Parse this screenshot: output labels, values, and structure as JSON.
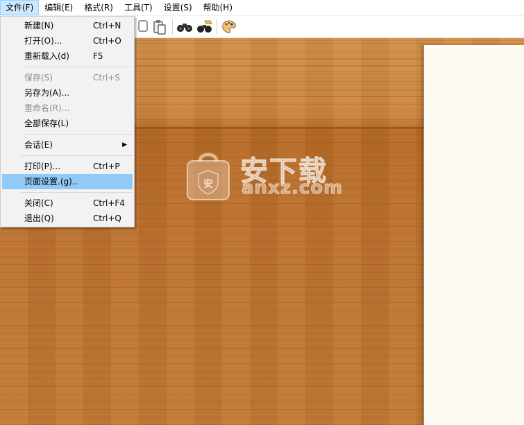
{
  "menubar": {
    "items": [
      {
        "label": "文件(F)",
        "active": true
      },
      {
        "label": "编辑(E)"
      },
      {
        "label": "格式(R)"
      },
      {
        "label": "工具(T)"
      },
      {
        "label": "设置(S)"
      },
      {
        "label": "帮助(H)"
      }
    ]
  },
  "toolbar": {
    "icons": [
      "copy-icon",
      "paste-icon",
      "find-binoculars-icon",
      "find-replace-icon",
      "palette-icon"
    ]
  },
  "file_menu": {
    "items": [
      {
        "label": "新建(N)",
        "shortcut": "Ctrl+N"
      },
      {
        "label": "打开(O)...",
        "shortcut": "Ctrl+O"
      },
      {
        "label": "重新载入(d)",
        "shortcut": "F5"
      },
      {
        "label": "保存(S)",
        "shortcut": "Ctrl+S",
        "disabled": true
      },
      {
        "label": "另存为(A)..."
      },
      {
        "label": "重命名(R)...",
        "disabled": true
      },
      {
        "label": "全部保存(L)"
      },
      {
        "label": "会话(E)",
        "submenu": true
      },
      {
        "label": "打印(P)...",
        "shortcut": "Ctrl+P"
      },
      {
        "label": "页面设置.(g)..",
        "highlighted": true
      },
      {
        "label": "关闭(C)",
        "shortcut": "Ctrl+F4"
      },
      {
        "label": "退出(Q)",
        "shortcut": "Ctrl+Q"
      }
    ],
    "submenu_arrow": "▶"
  },
  "watermark": {
    "title": "安下载",
    "subtitle": "anxz.com",
    "badge": "安"
  },
  "colors": {
    "menu_highlight": "#91c9f7",
    "menubar_active": "#cce8ff",
    "wood": "#c4782f",
    "page": "#fdfaf3"
  }
}
